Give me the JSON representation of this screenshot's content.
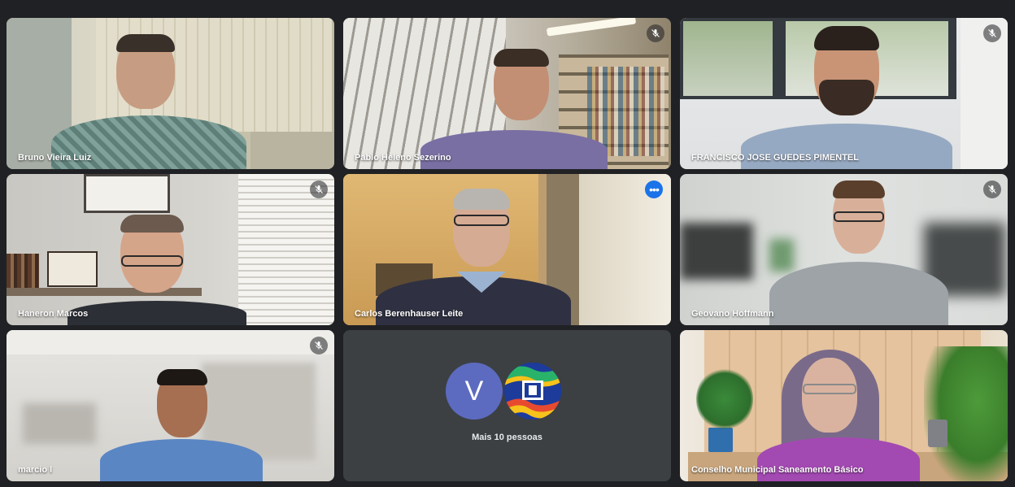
{
  "meeting": {
    "tiles": [
      {
        "name": "Bruno Vieira Luiz",
        "muted": false
      },
      {
        "name": "Pablo Heleno Sezerino",
        "muted": true
      },
      {
        "name": "FRANCISCO JOSE GUEDES PIMENTEL",
        "muted": true
      },
      {
        "name": "Haneron Marcos",
        "muted": true
      },
      {
        "name": "Carlos Berenhauser Leite",
        "muted": false,
        "speaking": true
      },
      {
        "name": "Geovano Hoffmann",
        "muted": true
      },
      {
        "name": "marcio l",
        "muted": true
      },
      {
        "name": "Conselho Municipal Saneamento Básico",
        "muted": false
      }
    ],
    "overflow": {
      "avatar_letter": "V",
      "label": "Mais 10 pessoas"
    },
    "icons": {
      "mute": "mic-off-icon",
      "more": "more-options-icon"
    },
    "colors": {
      "background": "#202124",
      "tile": "#3c4043",
      "speaking_border": "#8ab4f8",
      "avatar_v": "#5c6bc0"
    }
  }
}
